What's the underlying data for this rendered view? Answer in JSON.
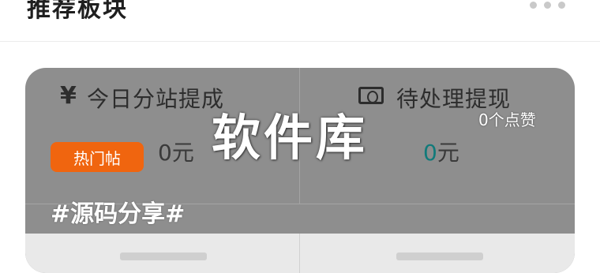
{
  "header": {
    "title": "推荐板块",
    "more_icon": "more-horizontal-icon"
  },
  "stats": {
    "commission": {
      "icon": "yen-icon",
      "symbol": "¥",
      "label": "今日分站提成",
      "value": "0元"
    },
    "withdraw": {
      "icon": "cash-icon",
      "label": "待处理提现",
      "value_num": "0",
      "value_unit": "元",
      "value_color": "#117a7a"
    }
  },
  "post": {
    "title": "软件库",
    "likes": "0个点赞",
    "badge": "热门帖",
    "badge_color": "#f0650f",
    "tag": "#源码分享#"
  }
}
